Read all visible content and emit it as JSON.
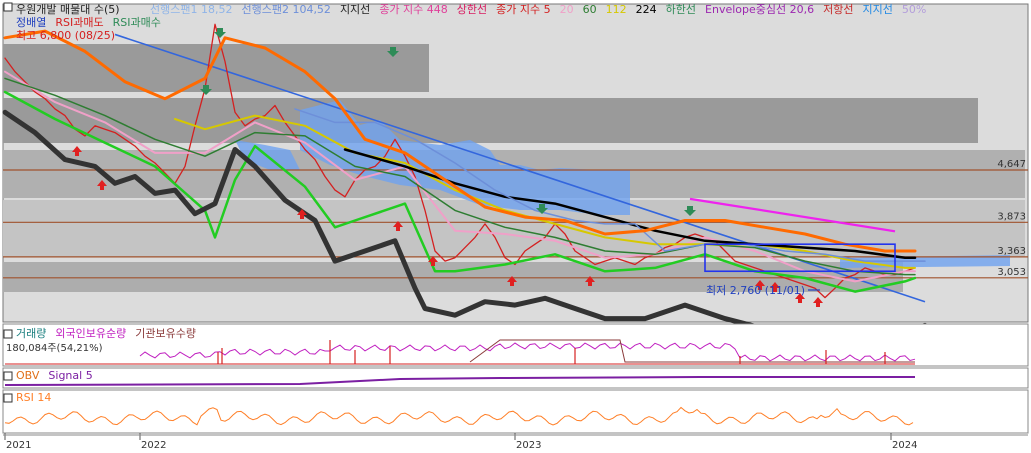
{
  "header": {
    "title": "우원개발 매물대 수(5)",
    "legend": [
      {
        "text": "선행스팬1 18,52",
        "color": "#8fb4e8"
      },
      {
        "text": "선행스팬2 104,52",
        "color": "#6d8fd9"
      },
      {
        "text": "지지선",
        "color": "#222222"
      },
      {
        "text": "종가 지수 448",
        "color": "#e0409a"
      },
      {
        "text": "상한선",
        "color": "#d81b60"
      },
      {
        "text": "종가 지수 5",
        "color": "#d42020"
      },
      {
        "text": "20",
        "color": "#f0a0c8"
      },
      {
        "text": "60",
        "color": "#2e7d32"
      },
      {
        "text": "112",
        "color": "#d6c800"
      },
      {
        "text": "224",
        "color": "#000000"
      },
      {
        "text": "하한선",
        "color": "#2e8b57"
      },
      {
        "text": "Envelope중심선 20,6",
        "color": "#9c27b0"
      },
      {
        "text": "저항선",
        "color": "#c62828"
      },
      {
        "text": "지지선",
        "color": "#1e88e5"
      },
      {
        "text": "50%",
        "color": "#b39ddb"
      }
    ],
    "sub_legend": [
      {
        "text": "정배열",
        "color": "#1f3fbf"
      },
      {
        "text": "RSI과매도",
        "color": "#d42020"
      },
      {
        "text": "RSI과매수",
        "color": "#2e8b57"
      }
    ],
    "high_label": "최고 6,800 (08/25)",
    "low_label": "최저 2,760 (11/01)"
  },
  "chart_data": {
    "type": "line",
    "title": "우원개발",
    "x_ticks": [
      "2021",
      "2022",
      "2023",
      "2024"
    ],
    "price_levels": [
      {
        "label": "4,647",
        "value": 4647
      },
      {
        "label": "3,873",
        "value": 3873
      },
      {
        "label": "3,363",
        "value": 3363
      },
      {
        "label": "3,053",
        "value": 3053
      }
    ],
    "ylim": [
      2400,
      7100
    ],
    "high": {
      "value": 6800,
      "date": "08/25"
    },
    "low": {
      "value": 2760,
      "date": "11/01"
    },
    "series": [
      {
        "name": "종가 지수 5",
        "color": "#d42020",
        "x": [
          0,
          10,
          20,
          30,
          40,
          50,
          60,
          70,
          80,
          90,
          100,
          110,
          120,
          130,
          140,
          150,
          160,
          170,
          180,
          190,
          200,
          210,
          220,
          230,
          240,
          250,
          260,
          270,
          280,
          290,
          300,
          310,
          320,
          330,
          340,
          350,
          360,
          370,
          380,
          390,
          400,
          410,
          420,
          430,
          440,
          450,
          460,
          470,
          480,
          490,
          500,
          510,
          520,
          530,
          540,
          550,
          560,
          570,
          580,
          590,
          600,
          610,
          620,
          630,
          640,
          650,
          660,
          670,
          680,
          690,
          700,
          710,
          720,
          730,
          740,
          750,
          760,
          770,
          780,
          790,
          800,
          810,
          820,
          830,
          840,
          850,
          860,
          870,
          880,
          890,
          900,
          910
        ],
        "values": [
          6300,
          6100,
          5950,
          5800,
          5700,
          5550,
          5450,
          5250,
          5150,
          5300,
          5250,
          5200,
          5100,
          5000,
          4850,
          4750,
          4600,
          4450,
          4700,
          5300,
          5850,
          6800,
          6250,
          5500,
          5300,
          5400,
          5450,
          5600,
          5350,
          5150,
          4950,
          4800,
          4550,
          4350,
          4250,
          4500,
          4650,
          4700,
          4850,
          5100,
          4850,
          4550,
          4050,
          3450,
          3300,
          3350,
          3500,
          3650,
          3850,
          3650,
          3350,
          3250,
          3450,
          3550,
          3650,
          3850,
          3700,
          3450,
          3350,
          3250,
          3300,
          3350,
          3300,
          3250,
          3350,
          3400,
          3500,
          3550,
          3650,
          3700,
          3650,
          3600,
          3450,
          3300,
          3250,
          3200,
          3150,
          3100,
          3050,
          3000,
          2950,
          2900,
          2760,
          2900,
          3050,
          3100,
          3200,
          3150,
          3100,
          3100,
          3150,
          3200
        ]
      },
      {
        "name": "20",
        "color": "#f0a0c8",
        "x": [
          0,
          50,
          100,
          150,
          200,
          250,
          300,
          350,
          400,
          450,
          500,
          550,
          600,
          650,
          700,
          750,
          800,
          850,
          900,
          910
        ],
        "values": [
          6100,
          5650,
          5350,
          4900,
          4900,
          5350,
          5050,
          4500,
          4700,
          3750,
          3700,
          3600,
          3350,
          3400,
          3650,
          3450,
          3150,
          3000,
          3150,
          3150
        ]
      },
      {
        "name": "60",
        "color": "#2e7d32",
        "x": [
          0,
          50,
          100,
          150,
          200,
          250,
          300,
          350,
          400,
          450,
          500,
          550,
          600,
          650,
          700,
          750,
          800,
          850,
          900,
          910
        ],
        "values": [
          6000,
          5750,
          5450,
          5100,
          4850,
          5200,
          5150,
          4700,
          4550,
          4050,
          3800,
          3650,
          3450,
          3400,
          3550,
          3500,
          3300,
          3150,
          3100,
          3100
        ]
      },
      {
        "name": "112",
        "color": "#d6c800",
        "x": [
          170,
          200,
          250,
          300,
          350,
          400,
          450,
          500,
          550,
          600,
          650,
          700,
          750,
          800,
          850,
          900,
          910
        ],
        "values": [
          5400,
          5250,
          5450,
          5300,
          4900,
          4750,
          4350,
          4050,
          3850,
          3650,
          3550,
          3550,
          3550,
          3450,
          3300,
          3200,
          3200
        ]
      },
      {
        "name": "224",
        "color": "#000000",
        "x": [
          340,
          400,
          450,
          500,
          550,
          600,
          650,
          700,
          750,
          800,
          850,
          900,
          910
        ],
        "values": [
          4950,
          4700,
          4450,
          4250,
          4150,
          3950,
          3750,
          3600,
          3550,
          3500,
          3450,
          3350,
          3350
        ]
      },
      {
        "name": "하한선",
        "color": "#22cc22",
        "x": [
          0,
          50,
          100,
          150,
          200,
          210,
          230,
          250,
          300,
          330,
          350,
          400,
          430,
          450,
          500,
          550,
          600,
          650,
          700,
          750,
          800,
          850,
          900,
          910
        ],
        "values": [
          5800,
          5400,
          5050,
          4700,
          4050,
          3650,
          4500,
          5000,
          4400,
          3800,
          3900,
          4150,
          3150,
          3150,
          3250,
          3400,
          3150,
          3200,
          3400,
          3150,
          3050,
          2850,
          3000,
          3050
        ]
      },
      {
        "name": "지지선",
        "color": "#333333",
        "x": [
          0,
          30,
          60,
          90,
          110,
          130,
          150,
          170,
          190,
          210,
          230,
          250,
          280,
          310,
          330,
          360,
          390,
          410,
          420,
          450,
          480,
          510,
          540,
          570,
          600,
          640,
          680,
          720,
          760,
          800,
          820,
          850,
          880,
          910,
          920
        ],
        "values": [
          5500,
          5200,
          4800,
          4700,
          4450,
          4550,
          4300,
          4350,
          4000,
          4150,
          4950,
          4700,
          4200,
          3900,
          3300,
          3450,
          3600,
          2900,
          2600,
          2500,
          2700,
          2650,
          2750,
          2600,
          2450,
          2450,
          2650,
          2450,
          2300,
          2200,
          2050,
          2200,
          2300,
          2300,
          2350
        ]
      },
      {
        "name": "선행스팬2",
        "color": "#6d8fd9",
        "x": [
          290,
          330,
          370,
          410,
          450,
          490,
          530,
          570,
          600,
          630,
          660,
          700,
          740,
          780,
          820,
          860,
          900,
          920
        ],
        "values": [
          5550,
          5350,
          5350,
          5100,
          4750,
          4350,
          4050,
          3900,
          3850,
          3850,
          3450,
          3550,
          3550,
          3450,
          3400,
          3300,
          3300,
          3300
        ]
      },
      {
        "name": "상한선",
        "color": "#ff6a00",
        "x": [
          0,
          40,
          80,
          120,
          160,
          200,
          220,
          260,
          300,
          330,
          360,
          400,
          440,
          480,
          520,
          560,
          600,
          640,
          680,
          720,
          760,
          800,
          840,
          880,
          910
        ],
        "values": [
          6600,
          6700,
          6400,
          5950,
          5700,
          6000,
          6600,
          6450,
          6100,
          5700,
          5100,
          4900,
          4500,
          4100,
          3950,
          3900,
          3700,
          3750,
          3900,
          3900,
          3800,
          3700,
          3550,
          3450,
          3450
        ]
      }
    ],
    "trendlines": [
      {
        "name": "저항선",
        "color": "#3366dd",
        "x": [
          110,
          920
        ],
        "values": [
          6650,
          2700
        ]
      },
      {
        "name": "Envelope중심선",
        "color": "#ee22ee",
        "x": [
          685,
          890
        ],
        "values": [
          4220,
          3740
        ]
      }
    ],
    "lower_panels": [
      {
        "name": "거래량",
        "legend": [
          "거래량",
          "외국인보유순량",
          "기관보유수량"
        ],
        "colors": [
          "#1a7f7f",
          "#c020c0",
          "#8a3a3a"
        ],
        "value_label": "180,084주(54,21%)"
      },
      {
        "name": "OBV",
        "legend": [
          "OBV",
          "Signal 5"
        ],
        "colors": [
          "#e0701a",
          "#7b1fa2"
        ]
      },
      {
        "name": "RSI 14",
        "legend": [
          "RSI 14"
        ],
        "colors": [
          "#ff7f27"
        ]
      }
    ]
  }
}
